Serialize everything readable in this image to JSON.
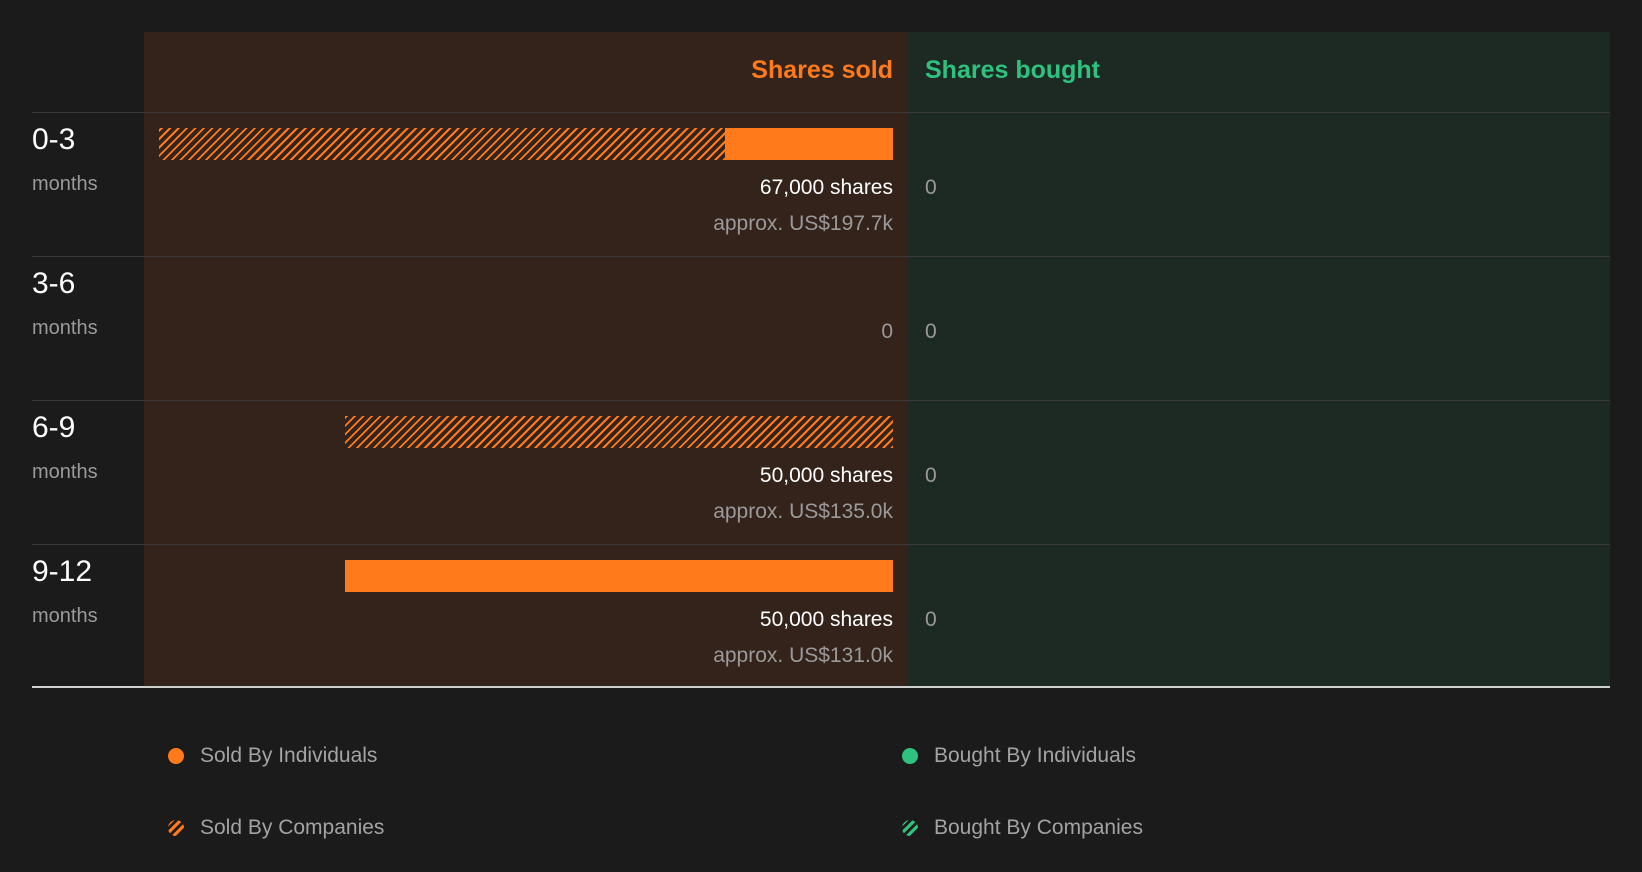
{
  "chart_data": {
    "type": "bar",
    "orientation": "horizontal",
    "headers": {
      "sold": "Shares sold",
      "bought": "Shares bought"
    },
    "rows": [
      {
        "period": "0-3",
        "unit": "months",
        "sold_individuals": 15300,
        "sold_companies": 51700,
        "shares_label": "67,000 shares",
        "approx_label": "approx. US$197.7k",
        "sold_zero_label": "",
        "bought_label": "0"
      },
      {
        "period": "3-6",
        "unit": "months",
        "sold_individuals": 0,
        "sold_companies": 0,
        "shares_label": "",
        "approx_label": "",
        "sold_zero_label": "0",
        "bought_label": "0"
      },
      {
        "period": "6-9",
        "unit": "months",
        "sold_individuals": 0,
        "sold_companies": 50000,
        "shares_label": "50,000 shares",
        "approx_label": "approx. US$135.0k",
        "sold_zero_label": "",
        "bought_label": "0"
      },
      {
        "period": "9-12",
        "unit": "months",
        "sold_individuals": 50000,
        "sold_companies": 0,
        "shares_label": "50,000 shares",
        "approx_label": "approx. US$131.0k",
        "sold_zero_label": "",
        "bought_label": "0"
      }
    ],
    "max_shares": 67000,
    "legend": [
      {
        "label": "Sold By Individuals",
        "color": "#ff7a1a",
        "style": "solid"
      },
      {
        "label": "Bought By Individuals",
        "color": "#2ec27e",
        "style": "solid"
      },
      {
        "label": "Sold By Companies",
        "color": "#ff7a1a",
        "style": "hatched"
      },
      {
        "label": "Bought By Companies",
        "color": "#2ec27e",
        "style": "hatched"
      }
    ],
    "colors": {
      "sold": "#ff7a1a",
      "bought": "#2ec27e",
      "sold_bg": "#34231b",
      "bought_bg": "#1d2a24"
    }
  }
}
